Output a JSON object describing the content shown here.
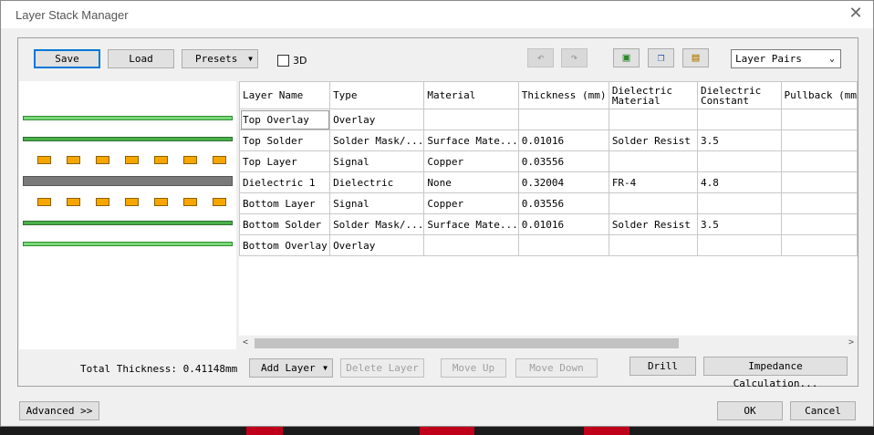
{
  "window": {
    "title": "Layer Stack Manager"
  },
  "toolbar": {
    "save": "Save",
    "load": "Load",
    "presets": "Presets",
    "checkbox_3d_label": "3D",
    "view_select": "Layer Pairs"
  },
  "grid": {
    "columns": [
      "Layer Name",
      "Type",
      "Material",
      "Thickness (mm)",
      "Dielectric Material",
      "Dielectric Constant",
      "Pullback (mm"
    ],
    "rows": [
      [
        "Top Overlay",
        "Overlay",
        "",
        "",
        "",
        "",
        ""
      ],
      [
        "Top Solder",
        "Solder Mask/...",
        "Surface Mate...",
        "0.01016",
        "Solder Resist",
        "3.5",
        ""
      ],
      [
        "Top Layer",
        "Signal",
        "Copper",
        "0.03556",
        "",
        "",
        ""
      ],
      [
        "Dielectric 1",
        "Dielectric",
        "None",
        "0.32004",
        "FR-4",
        "4.8",
        ""
      ],
      [
        "Bottom Layer",
        "Signal",
        "Copper",
        "0.03556",
        "",
        "",
        ""
      ],
      [
        "Bottom Solder",
        "Solder Mask/...",
        "Surface Mate...",
        "0.01016",
        "Solder Resist",
        "3.5",
        ""
      ],
      [
        "Bottom Overlay",
        "Overlay",
        "",
        "",
        "",
        "",
        ""
      ]
    ]
  },
  "footer": {
    "total_thickness": "Total Thickness: 0.41148mm",
    "add_layer": "Add Layer",
    "delete_layer": "Delete Layer",
    "move_up": "Move Up",
    "move_down": "Move Down",
    "drill": "Drill",
    "impedance": "Impedance Calculation...",
    "advanced": "Advanced >>",
    "ok": "OK",
    "cancel": "Cancel"
  },
  "icons": [
    "close-icon",
    "undo-icon",
    "redo-icon",
    "copy-special-icon",
    "copy-icon",
    "paste-icon",
    "dropdown-arrow-icon"
  ],
  "colors": {
    "overlay": "#7cd67c",
    "signal_pad": "#f7a600",
    "dielectric": "#7a7a7a",
    "solder": "#2f8f2f",
    "accent": "#0078d7"
  }
}
